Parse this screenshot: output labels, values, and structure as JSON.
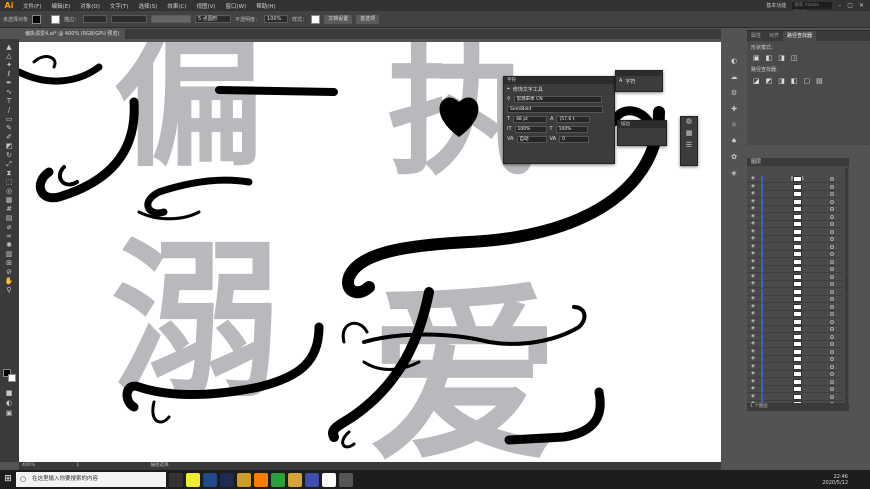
{
  "app": {
    "logo": "Ai"
  },
  "menu": [
    "文件(F)",
    "编辑(E)",
    "对象(O)",
    "文字(T)",
    "选择(S)",
    "效果(C)",
    "视图(V)",
    "窗口(W)",
    "帮助(H)"
  ],
  "workspace": "基本功能",
  "search_placeholder": "搜索 Adobe Stock",
  "control_bar": {
    "selection_label": "未选择对象",
    "stroke_label": "描边：",
    "stroke_value": "",
    "profile": "5 点圆形",
    "opacity_label": "不透明度：",
    "opacity_value": "100%",
    "style_label": "样式：",
    "doc_setup": "文档设置",
    "preferences": "首选项"
  },
  "document_tab": "偏执溺爱4.ai* @ 400% (RGB/GPU 预览)",
  "artwork": {
    "gray_chars": [
      "偏",
      "执",
      "溺",
      "爱"
    ],
    "gray_color": "#b9b9bd",
    "accent_color": "#000000"
  },
  "character_panel": {
    "title": "字符",
    "touch_type": "修饰文字工具",
    "font_family": "思源宋体 CN",
    "font_style": "SemiBold",
    "size": "48 pt",
    "leading": "(57.6 t",
    "scale_v": "100%",
    "scale_h": "100%",
    "kerning": "自动",
    "tracking": "0"
  },
  "glyph_panel": {
    "title": "字符",
    "icon_label": "A"
  },
  "align_panel": {
    "title": "描边"
  },
  "properties_panel": {
    "tabs": [
      "属性",
      "对齐",
      "路径查找器"
    ],
    "shape_mode_label": "形状模式：",
    "pathfinder_label": "路径查找器："
  },
  "layers_panel": {
    "title": "图层",
    "layer_name": "图层 1",
    "footer": "1 个图层",
    "rows": 31
  },
  "status": {
    "zoom": "400%",
    "page": "1",
    "tool": "编组选择"
  },
  "taskbar": {
    "search_placeholder": "在这里输入你要搜索的内容",
    "time": "22:46",
    "date": "2020/5/12"
  }
}
